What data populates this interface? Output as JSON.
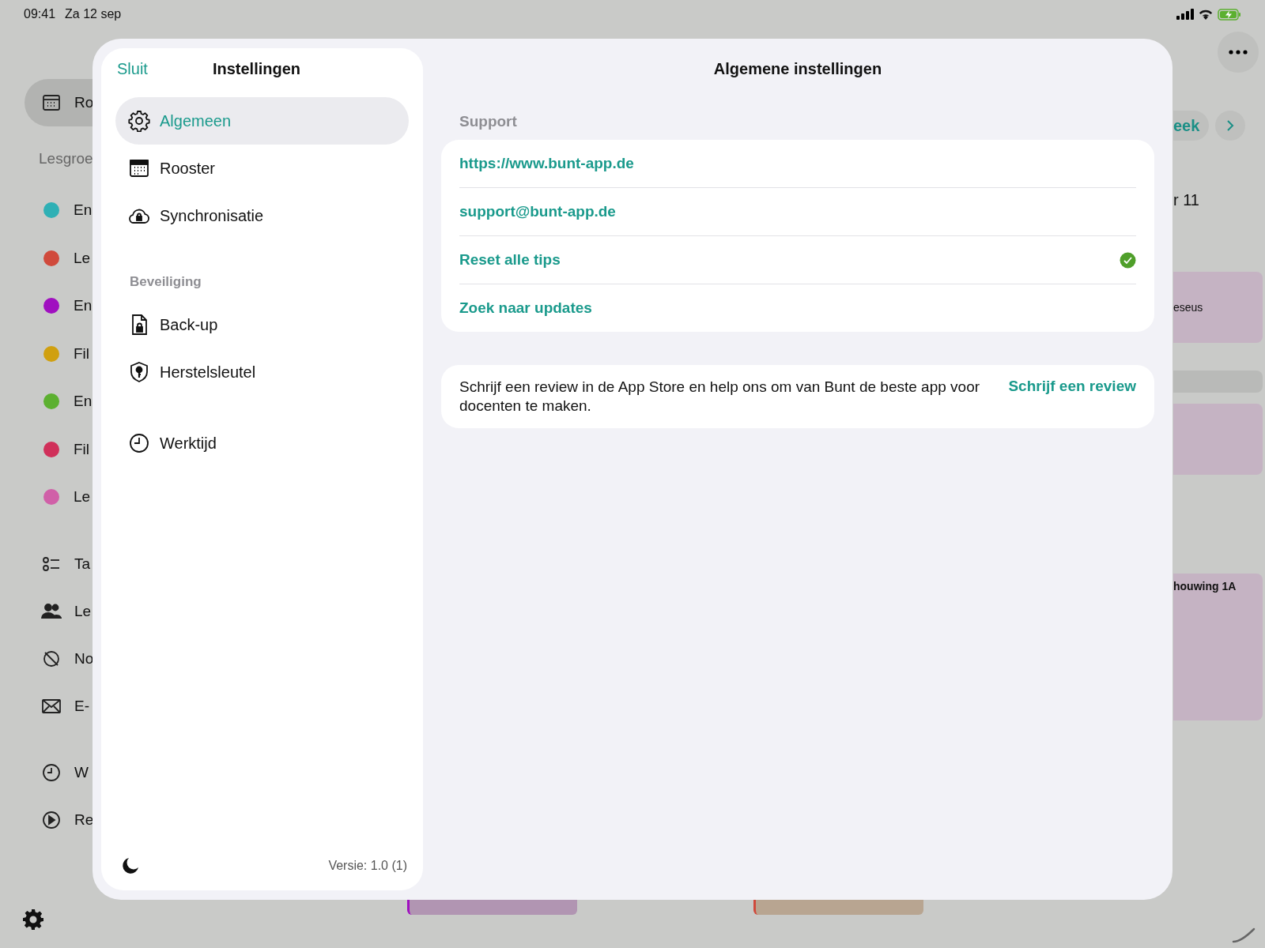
{
  "status_bar": {
    "time": "09:41",
    "date": "Za 12 sep"
  },
  "background_sidebar": {
    "items": [
      {
        "kind": "nav",
        "label": "Ro",
        "selected": true
      },
      {
        "kind": "heading",
        "label": "Lesgroe"
      },
      {
        "kind": "group",
        "label": "En",
        "color": "#2fb0b5"
      },
      {
        "kind": "group",
        "label": "Le",
        "color": "#d04a3c"
      },
      {
        "kind": "group",
        "label": "En",
        "color": "#a010c0"
      },
      {
        "kind": "group",
        "label": "Fil",
        "color": "#d0a010"
      },
      {
        "kind": "group",
        "label": "En",
        "color": "#5cb030"
      },
      {
        "kind": "group",
        "label": "Fil",
        "color": "#d0305a"
      },
      {
        "kind": "group",
        "label": "Le",
        "color": "#d060a8"
      },
      {
        "kind": "nav",
        "label": "Ta",
        "selected": false
      },
      {
        "kind": "nav",
        "label": "Le",
        "selected": false
      },
      {
        "kind": "nav",
        "label": "No",
        "selected": false
      },
      {
        "kind": "nav",
        "label": "E-",
        "selected": false
      },
      {
        "kind": "nav",
        "label": "W",
        "selected": false
      },
      {
        "kind": "nav",
        "label": "Re",
        "selected": false
      }
    ]
  },
  "background_schedule": {
    "week_button": "eek",
    "column_header": "r 11",
    "events": [
      {
        "label": "eseus",
        "bold": false
      },
      {
        "label": "houwing 1A",
        "bold": true
      }
    ]
  },
  "settings": {
    "close": "Sluit",
    "title": "Instellingen",
    "sections": [
      {
        "items": [
          {
            "label": "Algemeen",
            "selected": true
          },
          {
            "label": "Rooster",
            "selected": false
          },
          {
            "label": "Synchronisatie",
            "selected": false
          }
        ]
      },
      {
        "heading": "Beveiliging",
        "items": [
          {
            "label": "Back-up",
            "selected": false
          },
          {
            "label": "Herstelsleutel",
            "selected": false
          }
        ]
      },
      {
        "items": [
          {
            "label": "Werktijd",
            "selected": false
          }
        ]
      }
    ],
    "version": "Versie: 1.0 (1)"
  },
  "detail": {
    "title": "Algemene instellingen",
    "section": "Support",
    "rows": [
      {
        "label": "https://www.bunt-app.de",
        "done": false
      },
      {
        "label": "support@bunt-app.de",
        "done": false
      },
      {
        "label": "Reset alle tips",
        "done": true
      },
      {
        "label": "Zoek naar updates",
        "done": false
      }
    ],
    "review": {
      "text": "Schrijf een review in de App Store en help ons om van Bunt de beste app voor docenten te maken.",
      "action": "Schrijf een review"
    }
  }
}
